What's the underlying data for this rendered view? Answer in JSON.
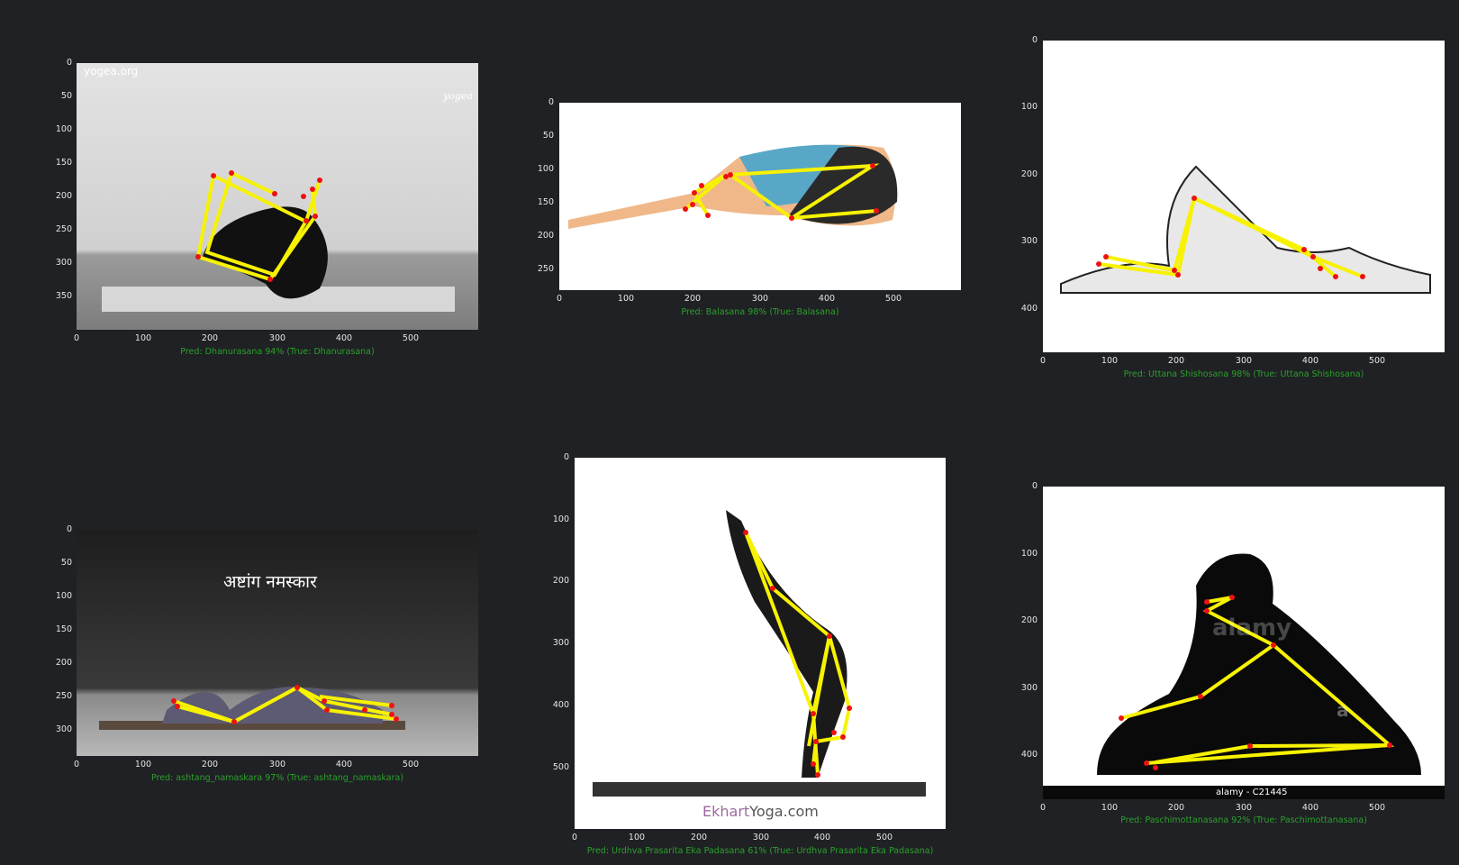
{
  "panels": [
    {
      "id": "dhanurasana",
      "caption": "Pred: Dhanurasana 94% (True: Dhanurasana)",
      "yticks": [
        "0",
        "50",
        "100",
        "150",
        "200",
        "250",
        "300",
        "350"
      ],
      "xticks": [
        "0",
        "100",
        "200",
        "300",
        "400",
        "500"
      ],
      "overlay": [
        "yogea.org",
        "yogea"
      ]
    },
    {
      "id": "balasana",
      "caption": "Pred: Balasana 98% (True: Balasana)",
      "yticks": [
        "0",
        "50",
        "100",
        "150",
        "200",
        "250"
      ],
      "xticks": [
        "0",
        "100",
        "200",
        "300",
        "400",
        "500"
      ],
      "overlay": []
    },
    {
      "id": "uttana-shishosana",
      "caption": "Pred: Uttana Shishosana 98% (True: Uttana Shishosana)",
      "yticks": [
        "0",
        "100",
        "200",
        "300",
        "400"
      ],
      "xticks": [
        "0",
        "100",
        "200",
        "300",
        "400",
        "500"
      ],
      "overlay": []
    },
    {
      "id": "ashtang-namaskara",
      "caption": "Pred: ashtang_namaskara 97% (True: ashtang_namaskara)",
      "yticks": [
        "0",
        "50",
        "100",
        "150",
        "200",
        "250",
        "300"
      ],
      "xticks": [
        "0",
        "100",
        "200",
        "300",
        "400",
        "500"
      ],
      "overlay": [
        "अष्टांग नमस्कार"
      ]
    },
    {
      "id": "urdhva-prasarita",
      "caption": "Pred: Urdhva Prasarita Eka Padasana 61% (True: Urdhva Prasarita Eka Padasana)",
      "yticks": [
        "0",
        "100",
        "200",
        "300",
        "400",
        "500"
      ],
      "xticks": [
        "0",
        "100",
        "200",
        "300",
        "400",
        "500"
      ],
      "overlay": [
        "Ekhart",
        "Yoga.com"
      ]
    },
    {
      "id": "paschimottanasana",
      "caption": "Pred: Paschimottanasana 92% (True: Paschimottanasana)",
      "yticks": [
        "0",
        "100",
        "200",
        "300",
        "400"
      ],
      "xticks": [
        "0",
        "100",
        "200",
        "300",
        "400",
        "500"
      ],
      "overlay": [
        "alamy - C21445",
        "alamy",
        "a"
      ]
    }
  ],
  "colors": {
    "background": "#1f2124",
    "skeleton_line": "#f7f200",
    "keypoint": "#ee1111",
    "caption": "#2ca02c",
    "tick_text": "#e6e6e6"
  }
}
